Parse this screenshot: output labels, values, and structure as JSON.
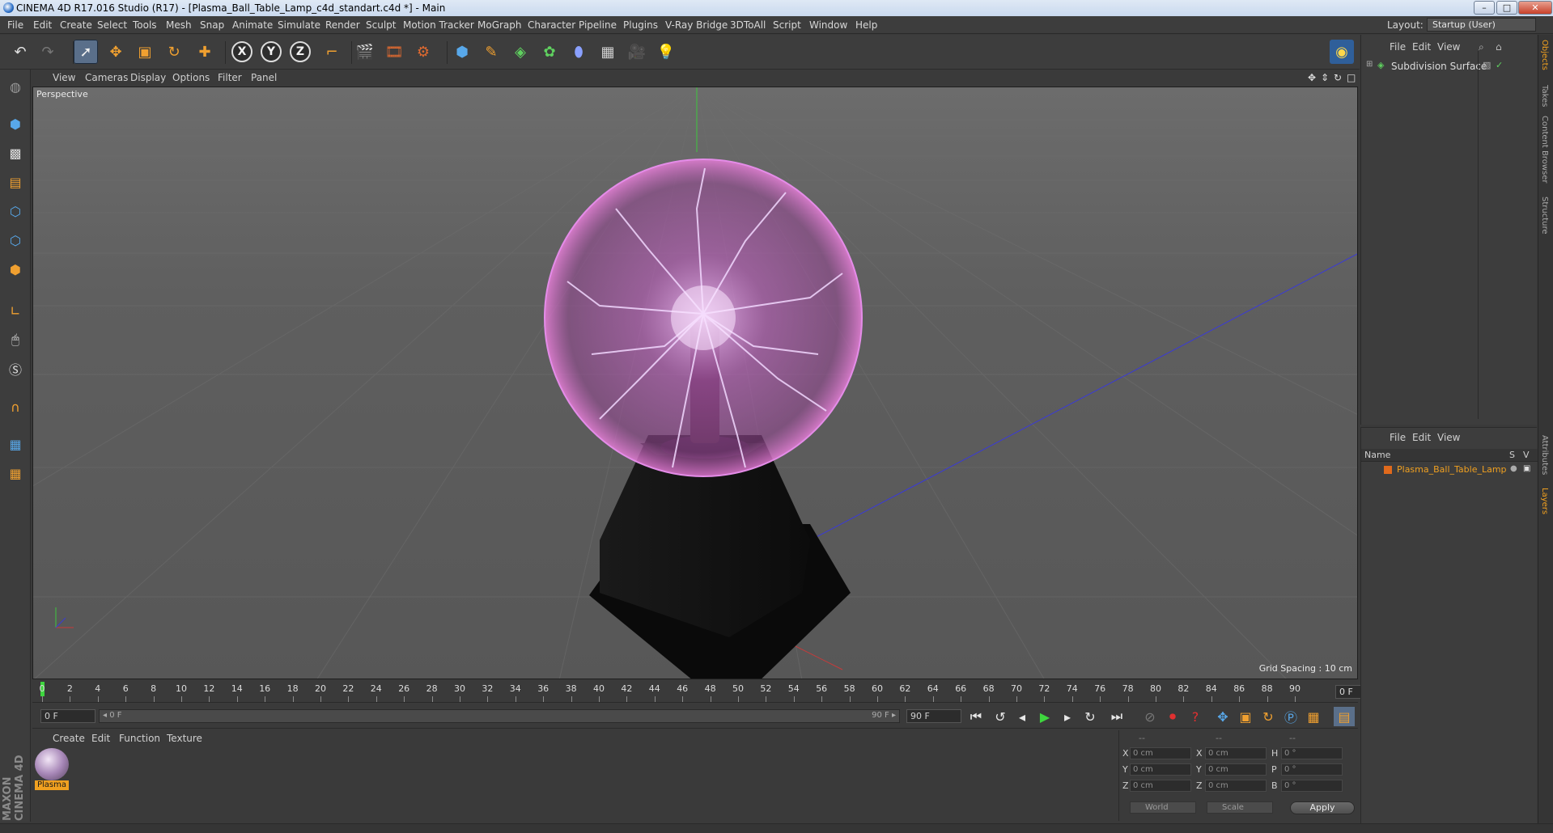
{
  "window": {
    "title": "CINEMA 4D R17.016 Studio (R17) - [Plasma_Ball_Table_Lamp_c4d_standart.c4d *] - Main",
    "minimize": "–",
    "maximize": "□",
    "close": "✕"
  },
  "menubar": {
    "items": [
      "File",
      "Edit",
      "Create",
      "Select",
      "Tools",
      "Mesh",
      "Snap",
      "Animate",
      "Simulate",
      "Render",
      "Sculpt",
      "Motion Tracker",
      "MoGraph",
      "Character",
      "Pipeline",
      "Plugins",
      "V-Ray Bridge",
      "3DToAll",
      "Script",
      "Window",
      "Help"
    ],
    "layout_label": "Layout:",
    "layout_value": "Startup (User)"
  },
  "toolbar": {
    "axis_x": "X",
    "axis_y": "Y",
    "axis_z": "Z"
  },
  "viewport": {
    "menu": [
      "View",
      "Cameras",
      "Display",
      "Options",
      "Filter",
      "Panel"
    ],
    "label": "Perspective",
    "grid_spacing": "Grid Spacing : 10 cm"
  },
  "timeline": {
    "ticks": [
      "0",
      "2",
      "4",
      "6",
      "8",
      "10",
      "12",
      "14",
      "16",
      "18",
      "20",
      "22",
      "24",
      "26",
      "28",
      "30",
      "32",
      "34",
      "36",
      "38",
      "40",
      "42",
      "44",
      "46",
      "48",
      "50",
      "52",
      "54",
      "56",
      "58",
      "60",
      "62",
      "64",
      "66",
      "68",
      "70",
      "72",
      "74",
      "76",
      "78",
      "80",
      "82",
      "84",
      "86",
      "88",
      "90"
    ],
    "current_frame": "0 F"
  },
  "transport": {
    "start_field": "0 F",
    "range_start": "◂ 0 F",
    "range_end": "90 F ▸",
    "end_field": "90 F"
  },
  "material_manager": {
    "menu": [
      "Create",
      "Edit",
      "Function",
      "Texture"
    ],
    "materials": [
      {
        "name": "Plasma"
      }
    ]
  },
  "coordinates": {
    "header": [
      "--",
      "--",
      "--"
    ],
    "rows": [
      {
        "axis": "X",
        "pos": "0 cm",
        "axis2": "X",
        "size": "0 cm",
        "rot_label": "H",
        "rot": "0 °"
      },
      {
        "axis": "Y",
        "pos": "0 cm",
        "axis2": "Y",
        "size": "0 cm",
        "rot_label": "P",
        "rot": "0 °"
      },
      {
        "axis": "Z",
        "pos": "0 cm",
        "axis2": "Z",
        "size": "0 cm",
        "rot_label": "B",
        "rot": "0 °"
      }
    ],
    "mode": "World",
    "size_mode": "Scale",
    "apply": "Apply"
  },
  "object_manager": {
    "menu": [
      "File",
      "Edit",
      "View"
    ],
    "objects": [
      {
        "name": "Subdivision Surface"
      }
    ]
  },
  "layer_manager": {
    "menu": [
      "File",
      "Edit",
      "View"
    ],
    "columns": {
      "name": "Name",
      "s": "S",
      "v": "V"
    },
    "layers": [
      {
        "name": "Plasma_Ball_Table_Lamp",
        "color": "#e06a1c"
      }
    ]
  },
  "side_tabs": [
    "Objects",
    "Takes",
    "Content Browser",
    "Structure",
    "Attributes",
    "Layers"
  ],
  "branding": "MAXON CINEMA 4D",
  "colors": {
    "accent_blue": "#5a6f8a",
    "layer_orange": "#e06a1c",
    "plasma_pink": "#d64bd8"
  }
}
